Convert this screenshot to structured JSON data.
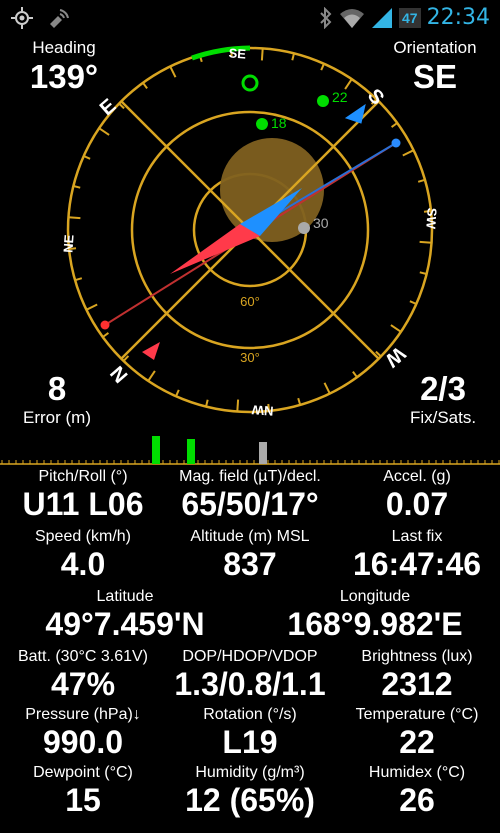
{
  "status": {
    "battery": "47",
    "time": "22:34"
  },
  "heading": {
    "label": "Heading",
    "value": "139°"
  },
  "orientation": {
    "label": "Orientation",
    "value": "SE"
  },
  "error": {
    "value": "8",
    "label": "Error (m)"
  },
  "fix": {
    "value": "2/3",
    "label": "Fix/Sats."
  },
  "compass": {
    "cardinals": [
      "E",
      "S",
      "W",
      "N"
    ],
    "intercardinals": [
      "SE",
      "SW",
      "NW",
      "NE"
    ],
    "rings": [
      "60°",
      "30°"
    ],
    "satellites": [
      {
        "id": "18",
        "color": "#00dd00"
      },
      {
        "id": "22",
        "color": "#00dd00"
      },
      {
        "id": "30",
        "color": "#aaaaaa"
      }
    ]
  },
  "readings": [
    {
      "label": "Pitch/Roll (°)",
      "value": "U11 L06"
    },
    {
      "label": "Mag. field (µT)/decl.",
      "value": "65/50/17°"
    },
    {
      "label": "Accel. (g)",
      "value": "0.07"
    },
    {
      "label": "Speed (km/h)",
      "value": "4.0"
    },
    {
      "label": "Altitude (m) MSL",
      "value": "837"
    },
    {
      "label": "Last fix",
      "value": "16:47:46"
    },
    {
      "label": "Latitude",
      "value": "49°7.459'N"
    },
    {
      "label": "Longitude",
      "value": "168°9.982'E"
    },
    {
      "label": "Batt. (30°C 3.61V)",
      "value": "47%"
    },
    {
      "label": "DOP/HDOP/VDOP",
      "value": "1.3/0.8/1.1"
    },
    {
      "label": "Brightness (lux)",
      "value": "2312"
    },
    {
      "label": "Pressure (hPa)↓",
      "value": "990.0"
    },
    {
      "label": "Rotation (°/s)",
      "value": "L19"
    },
    {
      "label": "Temperature (°C)",
      "value": "22"
    },
    {
      "label": "Dewpoint (°C)",
      "value": "15"
    },
    {
      "label": "Humidity (g/m³)",
      "value": "12 (65%)"
    },
    {
      "label": "Humidex (°C)",
      "value": "26"
    }
  ],
  "colors": {
    "accent": "#33b5e5",
    "ring": "#d9a521",
    "sat_green": "#00dd00"
  }
}
